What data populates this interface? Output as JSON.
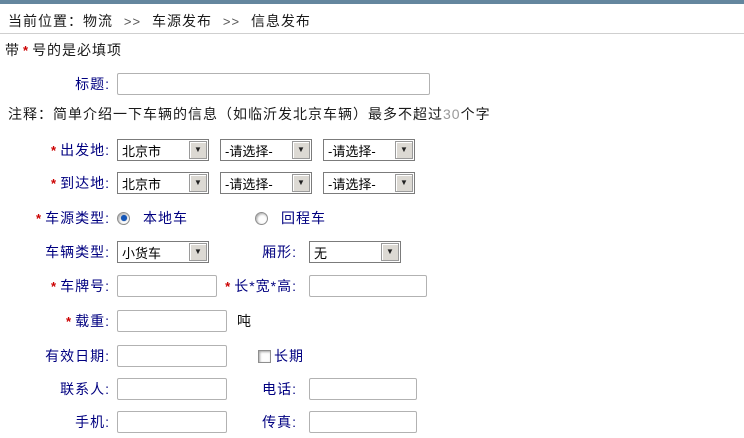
{
  "page": {
    "topbar_color": "#64869e",
    "accent_label_color": "#000080",
    "required_color": "#cc0000"
  },
  "breadcrumb": {
    "prefix": "当前位置：",
    "separator": ">>",
    "items": [
      {
        "label": "物流"
      },
      {
        "label": "车源发布"
      },
      {
        "label": "信息发布"
      }
    ]
  },
  "required_note": {
    "before": "带",
    "star": "*",
    "after": "号的是必填项"
  },
  "form": {
    "title": {
      "label": "标题:",
      "value": ""
    },
    "note": {
      "prefix": "注释：",
      "text": "简单介绍一下车辆的信息（如临沂发北京车辆）最多不超过",
      "count": "30",
      "suffix": "个字"
    },
    "departure": {
      "star": "*",
      "label": "出发地:",
      "province": "北京市",
      "city": "-请选择-",
      "district": "-请选择-"
    },
    "arrival": {
      "star": "*",
      "label": "到达地:",
      "province": "北京市",
      "city": "-请选择-",
      "district": "-请选择-"
    },
    "source_type": {
      "star": "*",
      "label": "车源类型:",
      "options": [
        {
          "label": "本地车",
          "checked": true
        },
        {
          "label": "回程车",
          "checked": false
        }
      ]
    },
    "vehicle_type": {
      "label": "车辆类型:",
      "value": "小货车"
    },
    "box_shape": {
      "label": "厢形:",
      "value": "无"
    },
    "plate": {
      "star": "*",
      "label": "车牌号:",
      "value": ""
    },
    "dimensions": {
      "star": "*",
      "label": "长*宽*高:",
      "value": ""
    },
    "load": {
      "star": "*",
      "label": "载重:",
      "value": "",
      "unit": "吨"
    },
    "valid_date": {
      "label": "有效日期:",
      "value": "",
      "long_term": {
        "label": "长期",
        "checked": false
      }
    },
    "contact": {
      "label": "联系人:",
      "value": ""
    },
    "phone": {
      "label": "电话:",
      "value": ""
    },
    "mobile": {
      "label": "手机:",
      "value": ""
    },
    "fax": {
      "label": "传真:",
      "value": ""
    }
  }
}
